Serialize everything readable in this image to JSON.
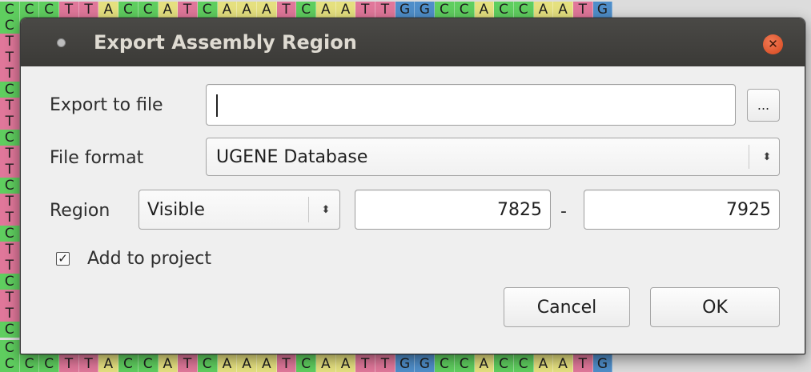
{
  "background_sequence": {
    "top_row": "CCCTTACCATCAAATCAATTGGCCACCAATG",
    "bottom_rows": [
      "CCCTTACCATCAAATCAATTGGCCACCAATG",
      "CCCTTACCATCAAATCAATTGGCCACCAATG"
    ],
    "left_column_letters": [
      "C",
      "T",
      "T",
      "T",
      "C",
      "T",
      "T",
      "C",
      "T",
      "T",
      "C",
      "T",
      "T",
      "C",
      "T",
      "T",
      "C",
      "T",
      "T",
      "C"
    ],
    "base_colors": {
      "A": "#e5e07f",
      "C": "#5fce5f",
      "G": "#4f8ec9",
      "T": "#e0779a"
    }
  },
  "dialog": {
    "title": "Export Assembly Region",
    "close_glyph": "✕",
    "export_to_file": {
      "label": "Export to file",
      "value": "",
      "browse_label": "..."
    },
    "file_format": {
      "label": "File format",
      "selected": "UGENE Database"
    },
    "region": {
      "label": "Region",
      "selected": "Visible",
      "start": "7825",
      "separator": "-",
      "end": "7925"
    },
    "add_to_project": {
      "label": "Add to project",
      "checked": true,
      "check_glyph": "✓"
    },
    "buttons": {
      "cancel": "Cancel",
      "ok": "OK"
    }
  }
}
